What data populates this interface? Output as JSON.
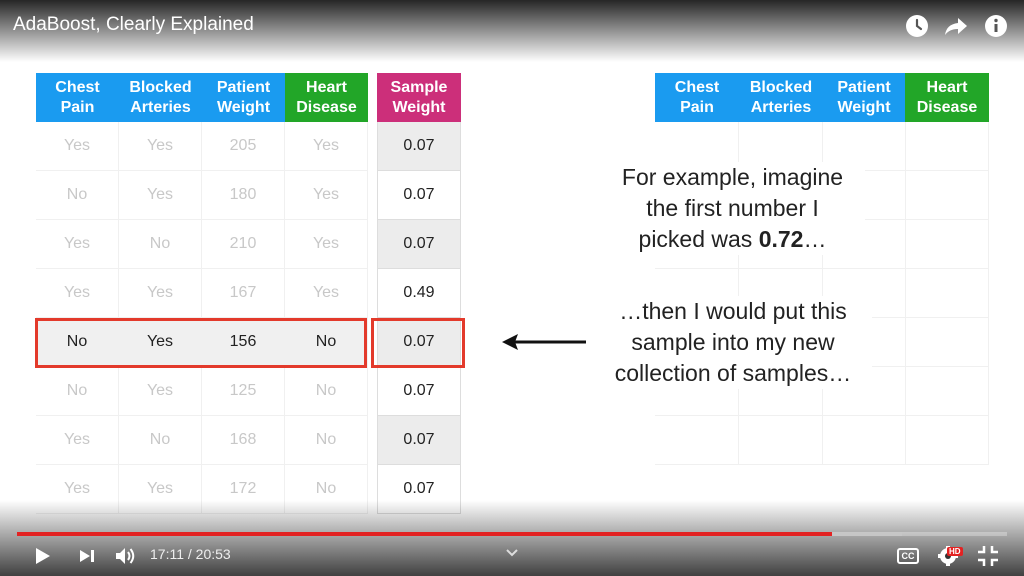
{
  "video": {
    "title": "AdaBoost, Clearly Explained",
    "time_current": "17:11",
    "time_separator": " / ",
    "time_total": "20:53",
    "progress_fraction": 0.823,
    "hd_badge": "HD",
    "cc_label": "CC"
  },
  "left_table": {
    "headers": [
      {
        "line1": "Chest",
        "line2": "Pain",
        "color": "#1a9bf0"
      },
      {
        "line1": "Blocked",
        "line2": "Arteries",
        "color": "#1a9bf0"
      },
      {
        "line1": "Patient",
        "line2": "Weight",
        "color": "#1a9bf0"
      },
      {
        "line1": "Heart",
        "line2": "Disease",
        "color": "#22a628"
      }
    ],
    "rows": [
      [
        "Yes",
        "Yes",
        "205",
        "Yes"
      ],
      [
        "No",
        "Yes",
        "180",
        "Yes"
      ],
      [
        "Yes",
        "No",
        "210",
        "Yes"
      ],
      [
        "Yes",
        "Yes",
        "167",
        "Yes"
      ],
      [
        "No",
        "Yes",
        "156",
        "No"
      ],
      [
        "No",
        "Yes",
        "125",
        "No"
      ],
      [
        "Yes",
        "No",
        "168",
        "No"
      ],
      [
        "Yes",
        "Yes",
        "172",
        "No"
      ]
    ],
    "highlighted_row": 4
  },
  "sample_weight": {
    "header_line1": "Sample",
    "header_line2": "Weight",
    "color": "#cc2f7a",
    "values": [
      "0.07",
      "0.07",
      "0.07",
      "0.49",
      "0.07",
      "0.07",
      "0.07",
      "0.07"
    ]
  },
  "right_table": {
    "headers": [
      {
        "line1": "Chest",
        "line2": "Pain",
        "color": "#1a9bf0"
      },
      {
        "line1": "Blocked",
        "line2": "Arteries",
        "color": "#1a9bf0"
      },
      {
        "line1": "Patient",
        "line2": "Weight",
        "color": "#1a9bf0"
      },
      {
        "line1": "Heart",
        "line2": "Disease",
        "color": "#22a628"
      }
    ]
  },
  "callout1": {
    "line1": "For example, imagine",
    "line2": "the first number I",
    "line3_prefix": "picked was ",
    "line3_bold": "0.72",
    "line3_suffix": "…"
  },
  "callout2": {
    "line1": "…then I would put this",
    "line2": "sample into my new",
    "line3": "collection of samples…"
  },
  "icons": {
    "watch_later": "clock-icon",
    "share": "share-icon",
    "info": "info-icon",
    "play": "play-icon",
    "next": "next-icon",
    "volume": "volume-icon",
    "chevron": "chevron-down-icon",
    "captions": "captions-icon",
    "settings": "settings-icon",
    "fullscreen": "fullscreen-icon"
  }
}
